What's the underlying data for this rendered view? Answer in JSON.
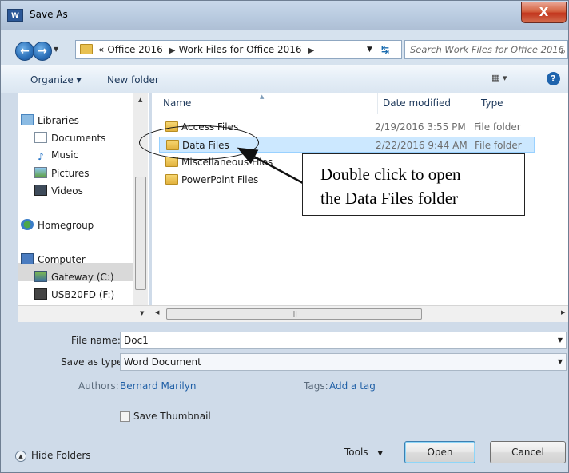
{
  "window": {
    "title": "Save As",
    "app_icon_text": "W",
    "close_label": "X"
  },
  "address": {
    "crumbs": [
      "«",
      "Office 2016",
      "Work Files for Office 2016"
    ],
    "search_placeholder": "Search Work Files for Office 2016"
  },
  "toolbar": {
    "organize_label": "Organize ▾",
    "newfolder_label": "New folder",
    "view_label": "▦ ▾",
    "help_label": "?"
  },
  "nav": {
    "libraries": "Libraries",
    "documents": "Documents",
    "music": "Music",
    "pictures": "Pictures",
    "videos": "Videos",
    "homegroup": "Homegroup",
    "computer": "Computer",
    "drive_c": "Gateway (C:)",
    "drive_f": "USB20FD (F:)"
  },
  "columns": {
    "name": "Name",
    "date": "Date modified",
    "type": "Type"
  },
  "files": [
    {
      "name": "Access Files",
      "date": "2/19/2016 3:55 PM",
      "type": "File folder"
    },
    {
      "name": "Data Files",
      "date": "2/22/2016 9:44 AM",
      "type": "File folder"
    },
    {
      "name": "Miscellaneous Files",
      "date": "",
      "type": ""
    },
    {
      "name": "PowerPoint Files",
      "date": "",
      "type": ""
    }
  ],
  "form": {
    "filename_label": "File name:",
    "filename_value": "Doc1",
    "savetype_label": "Save as type:",
    "savetype_value": "Word Document",
    "authors_label": "Authors:",
    "authors_value": "Bernard Marilyn",
    "tags_label": "Tags:",
    "tags_value": "Add a tag",
    "thumbnail_label": "Save Thumbnail"
  },
  "buttons": {
    "hide_folders": "Hide Folders",
    "tools": "Tools",
    "open": "Open",
    "cancel": "Cancel"
  },
  "callout": {
    "line1": "Double click to open",
    "line2": "the Data Files folder"
  },
  "colors": {
    "accent": "#1f5fa6",
    "selection": "#cce8ff",
    "close_red": "#c2351d"
  }
}
